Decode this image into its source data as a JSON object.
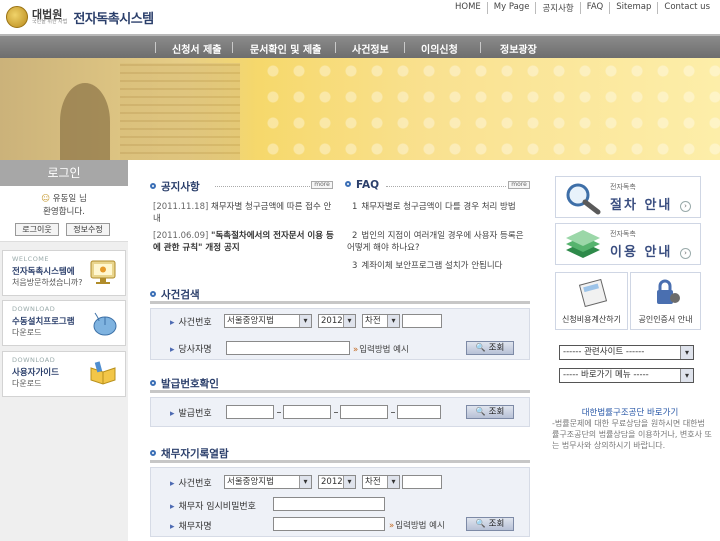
{
  "header": {
    "court_name": "대법원",
    "court_sub": "국민을 위한 사법",
    "system_name": "전자독촉시스템",
    "util_links": [
      "HOME",
      "My Page",
      "공지사항",
      "FAQ",
      "Sitemap",
      "Contact us"
    ]
  },
  "nav": {
    "items": [
      "신청서 제출",
      "문서확인 및 제출",
      "사건정보",
      "이의신청",
      "정보광장"
    ]
  },
  "login": {
    "title": "로그인",
    "user_line1": "유동일 님",
    "user_line2": "환영합니다.",
    "logout_label": "로그이웃",
    "edit_label": "정보수정"
  },
  "side_cards": [
    {
      "kicker": "WELCOME",
      "title": "전자독촉시스템에",
      "sub": "처음방문하셨습니까?",
      "icon": "monitor-icon"
    },
    {
      "kicker": "DOWNLOAD",
      "title": "수동설치프로그램",
      "sub": "다운로드",
      "icon": "mouse-icon"
    },
    {
      "kicker": "DOWNLOAD",
      "title": "사용자가이드",
      "sub": "다운로드",
      "icon": "book-icon"
    }
  ],
  "notice": {
    "title": "공지사항",
    "more": "more",
    "items": [
      {
        "date": "[2011.11.18]",
        "text": "채무자별 청구금액에 따른 접수 안내"
      },
      {
        "date": "[2011.06.09]",
        "text": "\"독촉절차에서의 전자문서 이용 등에 관한 규칙\" 개정 공지"
      }
    ]
  },
  "faq": {
    "title": "FAQ",
    "more": "more",
    "items": [
      {
        "num": "1",
        "text": "채무자별로 청구금액이 다를 경우 처리 방법"
      },
      {
        "num": "2",
        "text": "법인의 지점이 여러개일 경우에 사용자 등록은 어떻게 해야 하나요?"
      },
      {
        "num": "3",
        "text": "계좌이체 보안프로그램 설치가 안됩니다"
      }
    ]
  },
  "case_search": {
    "title": "사건검색",
    "case_no_label": "사건번호",
    "court": "서울중앙지법",
    "year": "2012",
    "case_type": "차전",
    "party_label": "당사자명",
    "hint": "입력방법 예시",
    "search_label": "조회"
  },
  "issue_check": {
    "title": "발급번호확인",
    "issue_no_label": "발급번호",
    "search_label": "조회"
  },
  "debtor_view": {
    "title": "채무자기록열람",
    "case_no_label": "사건번호",
    "court": "서울중앙지법",
    "year": "2012",
    "case_type": "차전",
    "temp_pw_label": "채무자 임시비밀번호",
    "debtor_name_label": "채무자명",
    "hint": "입력방법 예시",
    "search_label": "조회"
  },
  "right": {
    "guide_tiny": "전자독촉",
    "guide_big": "절차 안내",
    "usage_tiny": "전자독촉",
    "usage_big": "이용 안내",
    "quick1": "신청비용계산하기",
    "quick2": "공인인증서 안내",
    "related_sites": "------ 관련사이트 ------",
    "shortcut_menu": "----- 바로가기 메뉴 -----",
    "legal_title": "대한법률구조공단 바로가기",
    "legal_text": "-법률문제에 대한 무료상담을 원하시면 대한법률구조공단의 법률상담을 이용하거나, 변호사 또는 법무사와 상의하시기 바랍니다."
  },
  "colors": {
    "nav_bg": "#777777",
    "accent": "#2b3f6b",
    "banner": "#f6d86a"
  }
}
